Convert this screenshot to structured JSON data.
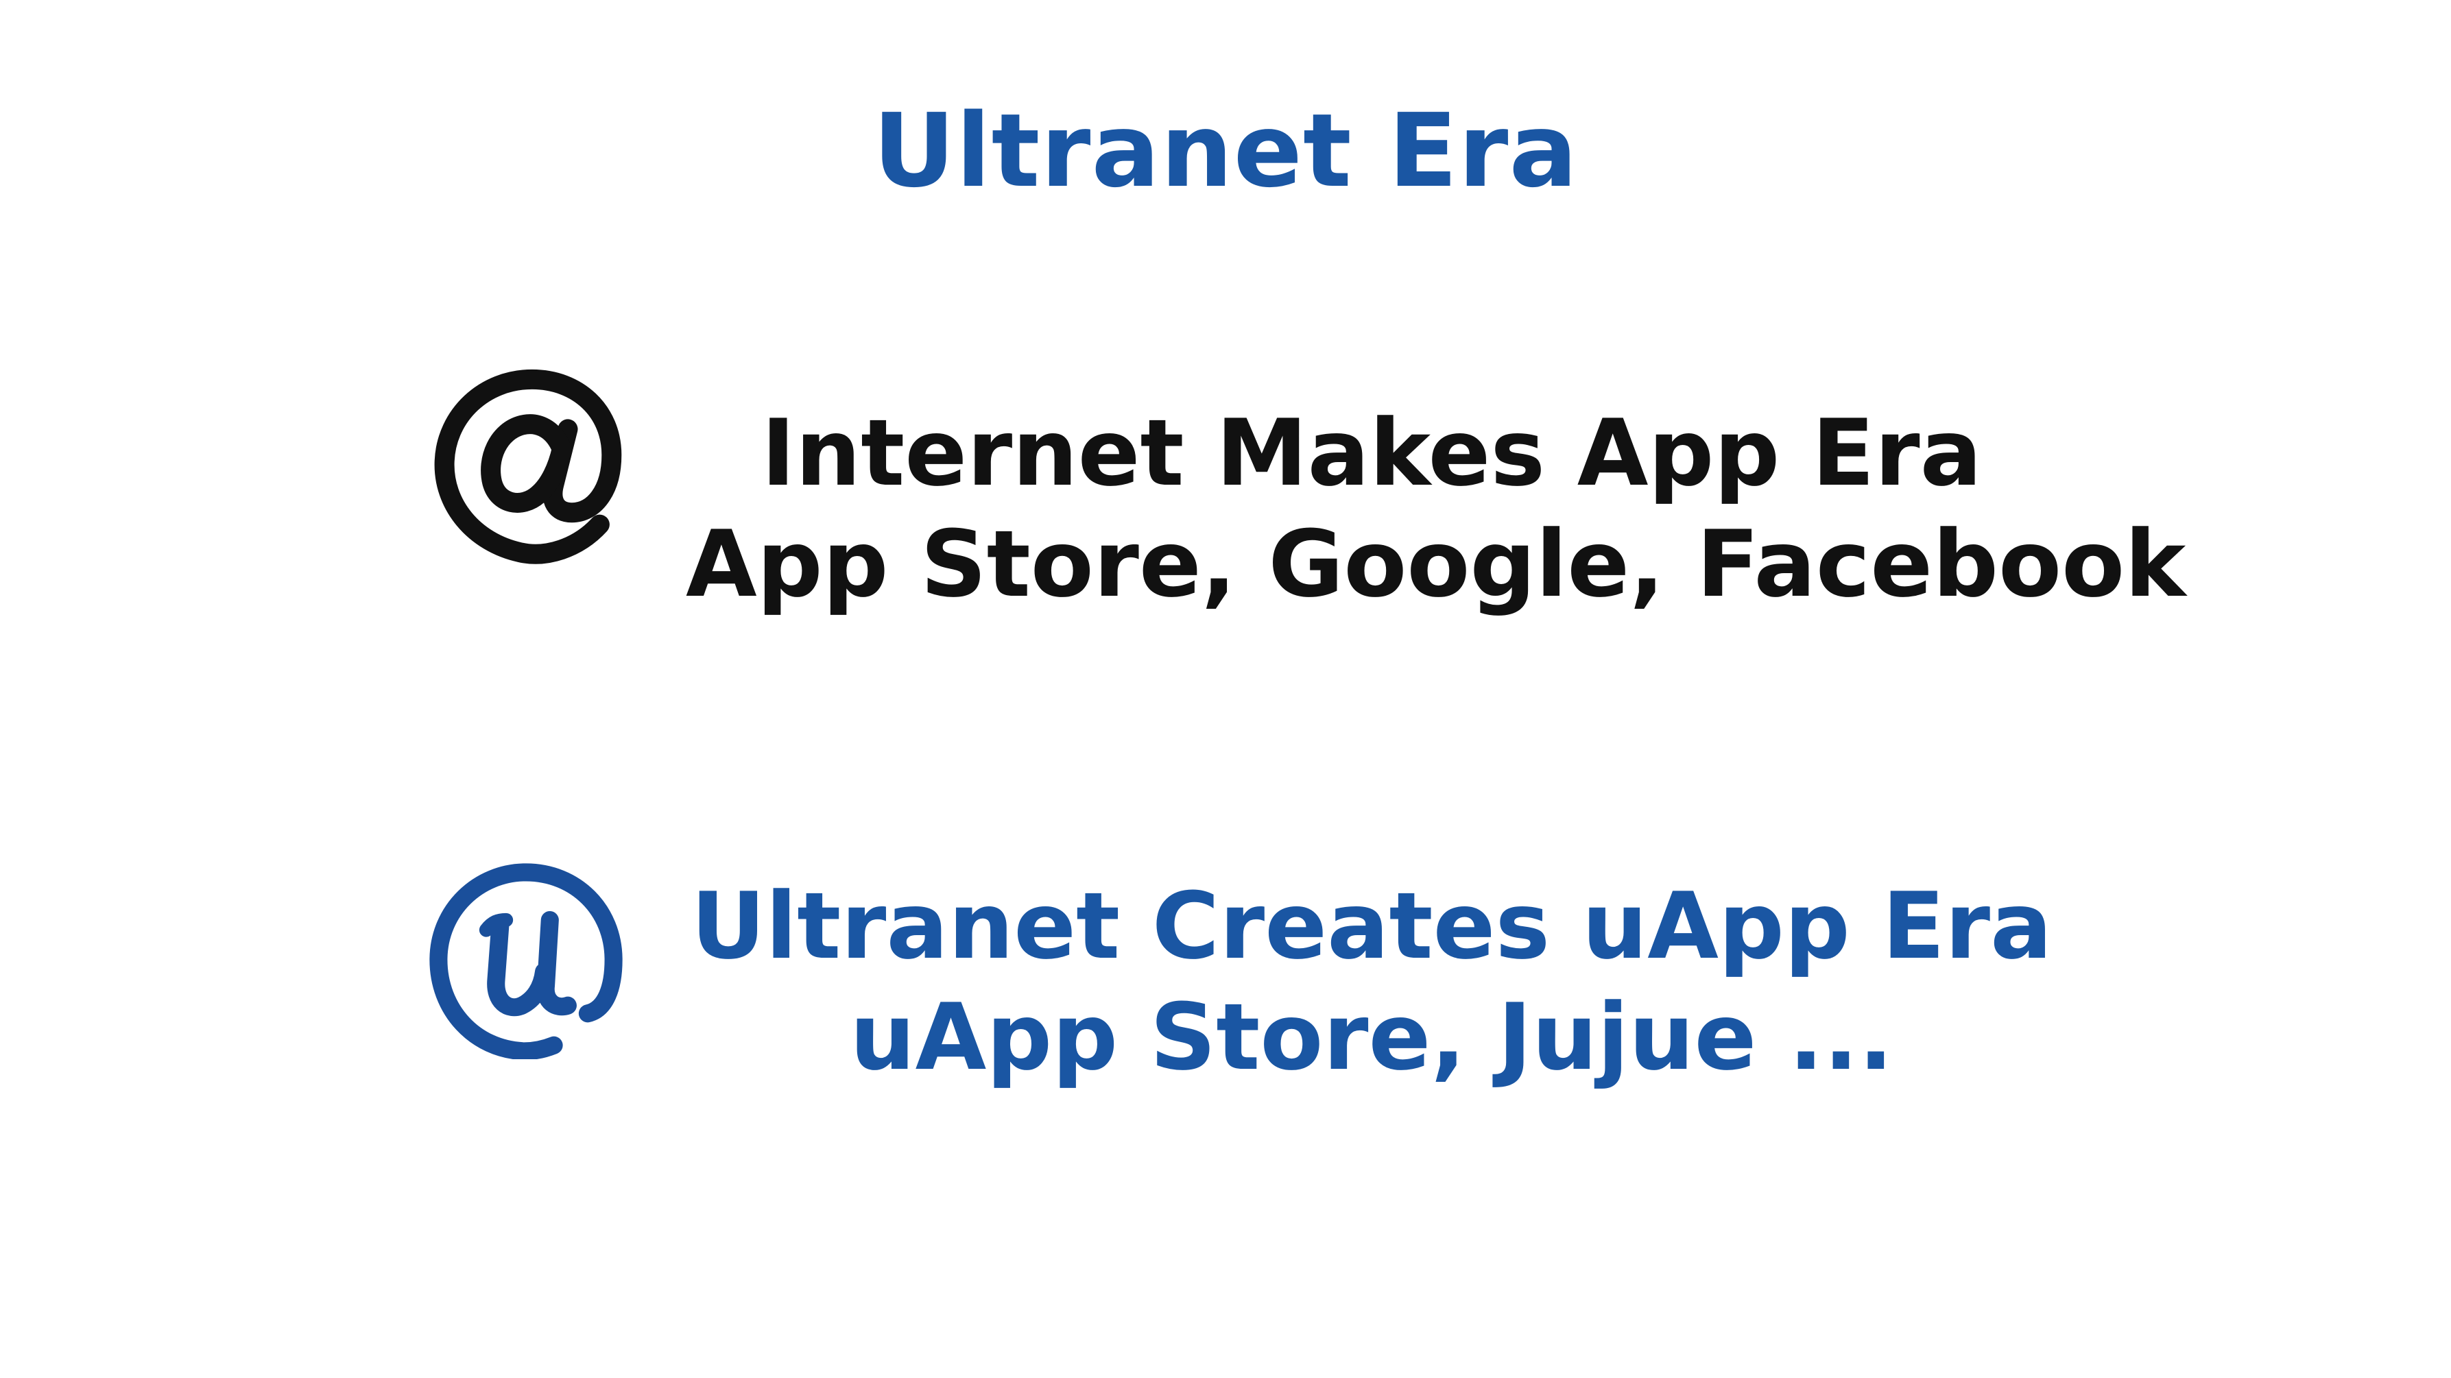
{
  "slide": {
    "title": "Ultranet Era",
    "colors": {
      "accent": "#1a56a3",
      "text": "#111111",
      "background": "#ffffff"
    },
    "internet": {
      "icon": "at-sign-icon",
      "line1": "Internet Makes App Era",
      "line2": "App Store, Google, Facebook"
    },
    "ultranet": {
      "icon": "u-at-sign-icon",
      "line1": "Ultranet Creates uApp Era",
      "line2": "uApp Store, Jujue ..."
    }
  }
}
